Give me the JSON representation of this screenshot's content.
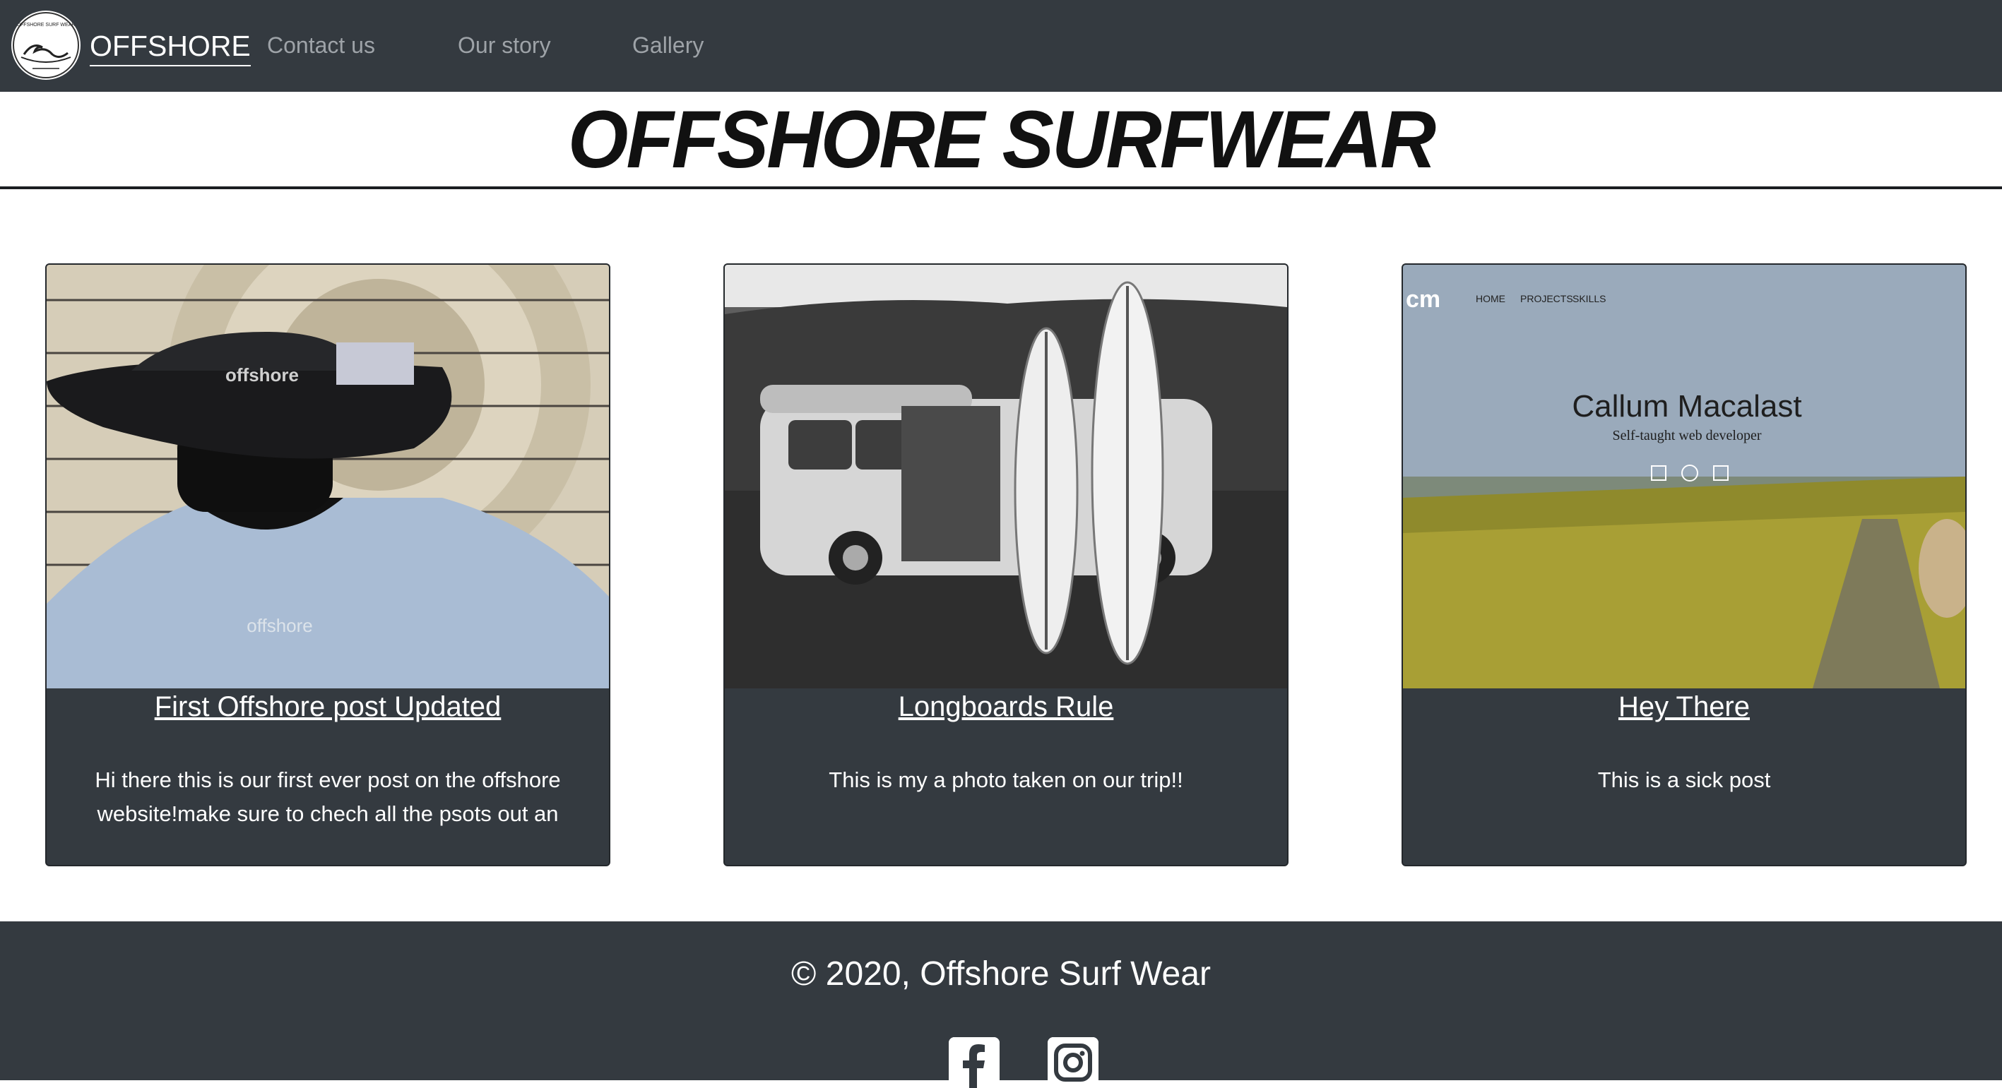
{
  "navbar": {
    "logo_text": "OFFSHORE SURF WEAR",
    "brand": "OFFSHORE",
    "links": [
      "Contact us",
      "Our story",
      "Gallery"
    ]
  },
  "header": {
    "title": "OFFSHORE SURFWEAR"
  },
  "cards": [
    {
      "title": "First Offshore post Updated",
      "text": "Hi there this is our first ever post on the offshore website!make sure to chech all the psots out an",
      "image": {
        "hat_text": "offshore",
        "shirt_text": "offshore"
      }
    },
    {
      "title": "Longboards Rule",
      "text": "This is my a photo taken on our trip!!",
      "image": {}
    },
    {
      "title": "Hey There",
      "text": "This is a sick post",
      "image": {
        "logo": "cm",
        "nav": [
          "HOME",
          "PROJECTS",
          "SKILLS"
        ],
        "name": "Callum Macalast",
        "tagline": "Self-taught web developer"
      }
    }
  ],
  "footer": {
    "copyright": "© 2020, Offshore Surf Wear",
    "social": [
      "facebook-icon",
      "instagram-icon"
    ]
  },
  "colors": {
    "dark": "#343a40",
    "nav_link": "#9ea3a8",
    "white": "#ffffff"
  }
}
